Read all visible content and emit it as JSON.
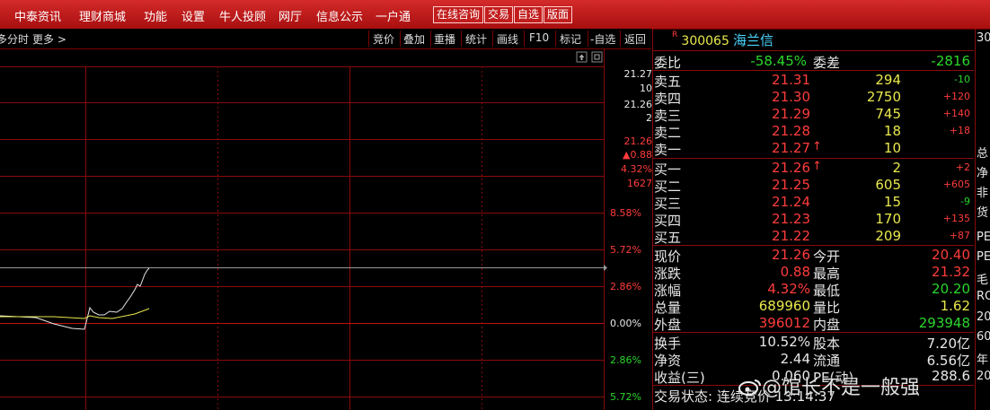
{
  "menu": {
    "items": [
      "中泰资讯",
      "理财商城",
      "功能",
      "设置",
      "牛人投顾",
      "网厅",
      "信息公示",
      "一户通"
    ],
    "buttons": [
      "在线咨询",
      "交易",
      "自选",
      "版面"
    ]
  },
  "toolbar": {
    "left_label": "多分时",
    "more_label": "更多",
    "more_arrow": ">",
    "items": [
      "竞价",
      "叠加",
      "重播",
      "统计",
      "画线",
      "F10",
      "标记",
      "-自选",
      "返回"
    ]
  },
  "chart": {
    "axis_top": [
      {
        "text": "21.27",
        "color": "#e8e8e8"
      },
      {
        "text": "10",
        "color": "#e8e8e8"
      },
      {
        "text": "21.26",
        "color": "#e8e8e8"
      },
      {
        "text": "2",
        "color": "#e8e8e8"
      },
      {
        "text": "21.26",
        "color": "#ff3c3c"
      },
      {
        "text": "▲0.88",
        "color": "#ff3c3c"
      },
      {
        "text": "4.32%",
        "color": "#ff3c3c"
      },
      {
        "text": "1627",
        "color": "#ff3c3c"
      }
    ],
    "axis_pct": [
      {
        "text": "8.58%",
        "color": "#ff3c3c"
      },
      {
        "text": "5.72%",
        "color": "#ff3c3c"
      },
      {
        "text": "2.86%",
        "color": "#ff3c3c"
      },
      {
        "text": "0.00%",
        "color": "#e8e8e8"
      },
      {
        "text": "2.86%",
        "color": "#2cd62c"
      },
      {
        "text": "5.72%",
        "color": "#2cd62c"
      }
    ],
    "corner_icons": [
      "upload-icon",
      "expand-icon"
    ]
  },
  "stock": {
    "flag": "R",
    "code": "300065",
    "name": "海兰信",
    "weibi_label": "委比",
    "weibi": "-58.45%",
    "weicha_label": "委差",
    "weicha": "-2816"
  },
  "asks": [
    {
      "label": "卖五",
      "price": "21.31",
      "vol": "294",
      "chg": "-10",
      "chg_color": "#2cd62c",
      "arrow": ""
    },
    {
      "label": "卖四",
      "price": "21.30",
      "vol": "2750",
      "chg": "+120",
      "chg_color": "#ff3c3c",
      "arrow": ""
    },
    {
      "label": "卖三",
      "price": "21.29",
      "vol": "745",
      "chg": "+140",
      "chg_color": "#ff3c3c",
      "arrow": ""
    },
    {
      "label": "卖二",
      "price": "21.28",
      "vol": "18",
      "chg": "+18",
      "chg_color": "#ff3c3c",
      "arrow": ""
    },
    {
      "label": "卖一",
      "price": "21.27",
      "vol": "10",
      "chg": "",
      "chg_color": "#ff3c3c",
      "arrow": "↑"
    }
  ],
  "bids": [
    {
      "label": "买一",
      "price": "21.26",
      "vol": "2",
      "chg": "+2",
      "chg_color": "#ff3c3c",
      "arrow": "↑"
    },
    {
      "label": "买二",
      "price": "21.25",
      "vol": "605",
      "chg": "+605",
      "chg_color": "#ff3c3c",
      "arrow": ""
    },
    {
      "label": "买三",
      "price": "21.24",
      "vol": "15",
      "chg": "-9",
      "chg_color": "#2cd62c",
      "arrow": ""
    },
    {
      "label": "买四",
      "price": "21.23",
      "vol": "170",
      "chg": "+135",
      "chg_color": "#ff3c3c",
      "arrow": ""
    },
    {
      "label": "买五",
      "price": "21.22",
      "vol": "209",
      "chg": "+87",
      "chg_color": "#ff3c3c",
      "arrow": ""
    }
  ],
  "quote": [
    {
      "l1": "现价",
      "v1": "21.26",
      "c1": "#ff3c3c",
      "l2": "今开",
      "v2": "20.40",
      "c2": "#ff3c3c"
    },
    {
      "l1": "涨跌",
      "v1": "0.88",
      "c1": "#ff3c3c",
      "l2": "最高",
      "v2": "21.32",
      "c2": "#ff3c3c"
    },
    {
      "l1": "涨幅",
      "v1": "4.32%",
      "c1": "#ff3c3c",
      "l2": "最低",
      "v2": "20.20",
      "c2": "#2cd62c"
    },
    {
      "l1": "总量",
      "v1": "689960",
      "c1": "#e8e84c",
      "l2": "量比",
      "v2": "1.62",
      "c2": "#e8e84c"
    },
    {
      "l1": "外盘",
      "v1": "396012",
      "c1": "#ff3c3c",
      "l2": "内盘",
      "v2": "293948",
      "c2": "#2cd62c"
    }
  ],
  "fundamentals": [
    {
      "l1": "换手",
      "v1": "10.52%",
      "l2": "股本",
      "v2": "7.20亿"
    },
    {
      "l1": "净资",
      "v1": "2.44",
      "l2": "流通",
      "v2": "6.56亿"
    },
    {
      "l1": "收益(三)",
      "v1": "0.060",
      "l2": "PE(动)",
      "v2": "288.6"
    }
  ],
  "status_line": "交易状态: 连续竞价 13:14:37",
  "far_right": [
    "30",
    "总",
    "净",
    "非",
    "货",
    "PE",
    "PE",
    "毛",
    "RO",
    "20",
    "60",
    "年",
    "20"
  ],
  "watermark": "@馆长不是一般强"
}
